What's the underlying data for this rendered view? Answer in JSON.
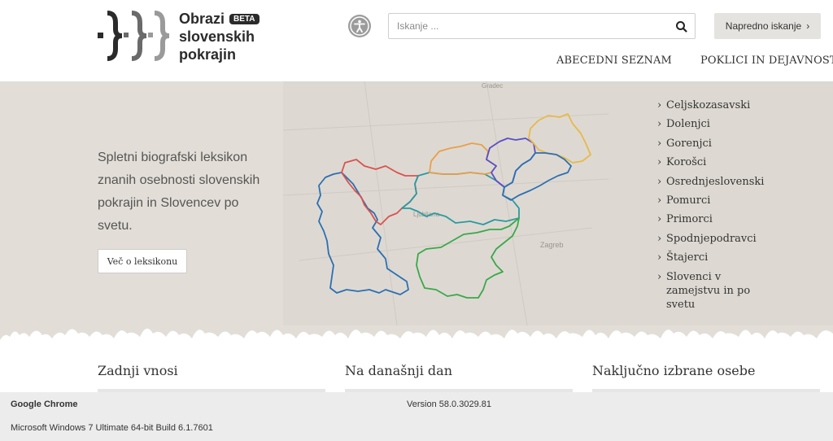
{
  "header": {
    "logo_line1": "Obrazi",
    "logo_badge": "BETA",
    "logo_line2": "slovenskih",
    "logo_line3": "pokrajin",
    "accessibility_icon": "accessibility-icon",
    "search_placeholder": "Iskanje ...",
    "search_icon": "search-icon",
    "advanced_search_label": "Napredno iskanje",
    "advanced_search_chevron": "›",
    "nav": [
      {
        "label": "ABECEDNI SEZNAM"
      },
      {
        "label": "POKLICI IN DEJAVNOSTI"
      }
    ]
  },
  "hero": {
    "description": "Spletni biografski leksikon znanih osebnosti slovenskih pokrajin in Slovencev po svetu.",
    "button_label": "Več o leksikonu",
    "regions": [
      {
        "label": "Celjskozasavski"
      },
      {
        "label": "Dolenjci"
      },
      {
        "label": "Gorenjci"
      },
      {
        "label": "Korošci"
      },
      {
        "label": "Osrednjeslovenski"
      },
      {
        "label": "Pomurci"
      },
      {
        "label": "Primorci"
      },
      {
        "label": "Spodnjepodravci"
      },
      {
        "label": "Štajerci"
      },
      {
        "label": "Slovenci v zamejstvu in po svetu"
      }
    ],
    "map_labels": {
      "graz": "Gradec",
      "ljubljana": "Ljubljana",
      "zagreb": "Zagreb"
    }
  },
  "sections": [
    {
      "title": "Zadnji vnosi"
    },
    {
      "title": "Na današnji dan"
    },
    {
      "title": "Naključno izbrane osebe"
    }
  ],
  "system": {
    "browser": "Google Chrome",
    "version": "Version 58.0.3029.81",
    "os": "Microsoft Windows 7 Ultimate  64-bit Build 6.1.7601"
  },
  "colors": {
    "hero_bg": "#e2ded7",
    "region_red": "#d9534f",
    "region_orange": "#e8a04a",
    "region_gold": "#e8b84a",
    "region_purple": "#5b4fc7",
    "region_blue": "#2c6fb3",
    "region_teal": "#2a9aa0",
    "region_green": "#3aa84a"
  }
}
